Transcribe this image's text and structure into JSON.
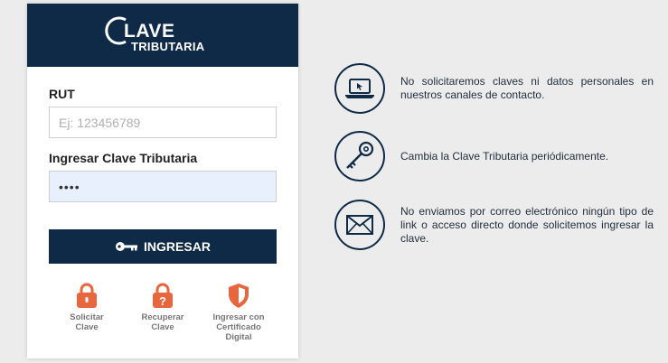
{
  "header": {
    "logo_line1": "LAVE",
    "logo_line2": "TRIBUTARIA"
  },
  "form": {
    "rut_label": "RUT",
    "rut_placeholder": "Ej: 123456789",
    "password_label": "Ingresar Clave Tributaria",
    "password_value": "••••",
    "login_button": "INGRESAR"
  },
  "links": [
    {
      "label": "Solicitar\nClave",
      "icon": "lock-icon"
    },
    {
      "label": "Recuperar\nClave",
      "icon": "lock-question-icon"
    },
    {
      "label": "Ingresar con\nCertificado\nDigital",
      "icon": "shield-icon"
    }
  ],
  "tips": [
    {
      "icon": "laptop-icon",
      "text": "No solicitaremos claves ni datos personales en nuestros canales de contacto."
    },
    {
      "icon": "key-icon",
      "text": "Cambia la Clave Tributaria periódicamente."
    },
    {
      "icon": "envelope-icon",
      "text": "No enviamos por correo electrónico ningún tipo de link o acceso directo donde solicitemos ingresar la clave."
    }
  ],
  "colors": {
    "primary": "#0e2a47",
    "accent": "#e8663d",
    "background": "#ececec"
  }
}
